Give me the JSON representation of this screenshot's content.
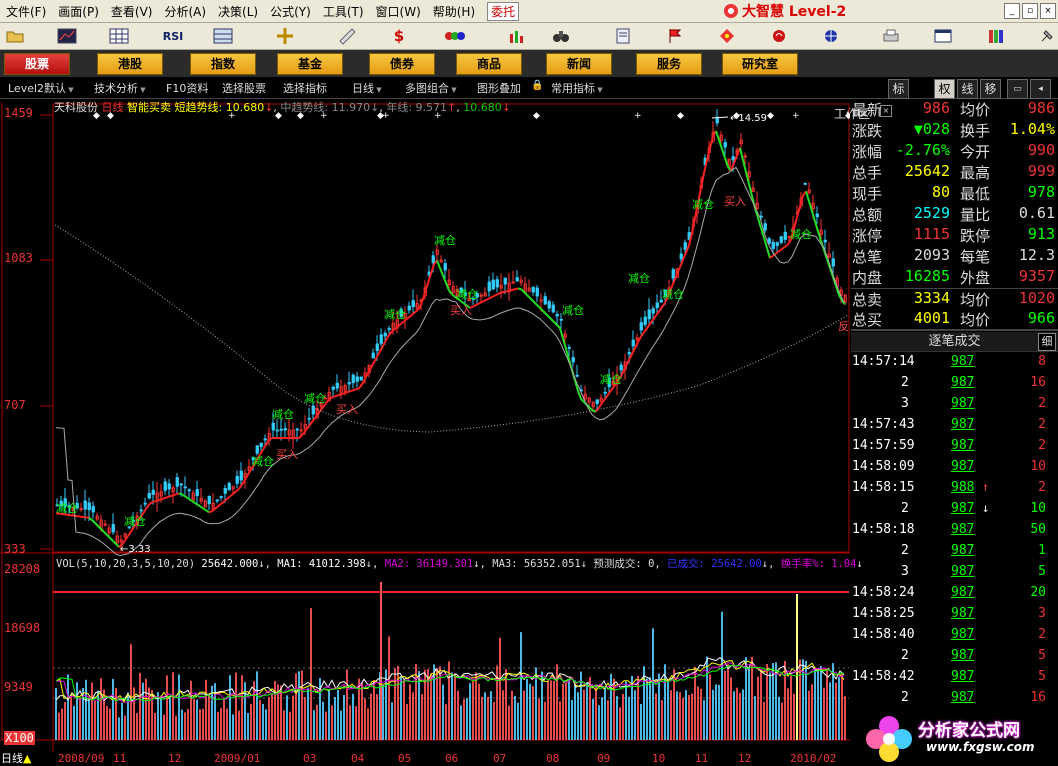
{
  "menu": [
    "文件(F)",
    "画面(P)",
    "查看(V)",
    "分析(A)",
    "决策(L)",
    "公式(Y)",
    "工具(T)",
    "窗口(W)",
    "帮助(H)"
  ],
  "entrust": "委托",
  "logo": "大智慧 Level-2",
  "nav": [
    "股票",
    "港股",
    "指数",
    "基金",
    "债券",
    "商品",
    "新闻",
    "服务",
    "研究室"
  ],
  "workarea": "工作区",
  "subbar": [
    "Level2默认",
    "技术分析",
    "F10资料",
    "选择股票",
    "选择指标",
    "日线",
    "多图组合",
    "图形叠加",
    "常用指标"
  ],
  "right_tabs": [
    "标",
    "权",
    "线",
    "移"
  ],
  "chart": {
    "title_name": "天科股份",
    "title_period": "日线",
    "title_ind": "智能买卖",
    "short_label": "短趋势线: 10.680",
    "mid_label": "中趋势线: 11.970",
    "year_label": "年线: 9.571",
    "extra_label": "10.680",
    "peak_label": "14.59",
    "low_label": "3.33",
    "y_labels": [
      "1459",
      "1083",
      "707",
      "333"
    ],
    "vol_labels": [
      "28208",
      "18698",
      "9349",
      "X100"
    ],
    "x_labels": [
      "2008/09",
      "11",
      "12",
      "2009/01",
      "03",
      "04",
      "05",
      "06",
      "07",
      "08",
      "09",
      "10",
      "11",
      "12",
      "2010/02"
    ],
    "vol_title": "VOL(5,10,20,3,5,10,20)",
    "vol_value": "25642.000",
    "ma1": "MA1: 41012.398",
    "ma2": "MA2: 36149.301",
    "ma3": "MA3: 56352.051",
    "forecast": "预测成交: 0,",
    "done": "已成交: 25642.00",
    "turnover": "换手率%: 1.04",
    "status": "日线",
    "signals": [
      "减仓",
      "买入",
      "减仓",
      "减仓",
      "减仓",
      "买入",
      "减仓",
      "买入",
      "减仓",
      "减仓",
      "减仓",
      "减仓",
      "减仓",
      "减仓",
      "买入",
      "减仓",
      "减仓",
      "反"
    ]
  },
  "quote": [
    {
      "k1": "最新",
      "v1": "986",
      "c1": "#e33",
      "k2": "均价",
      "v2": "986",
      "c2": "#e33"
    },
    {
      "k1": "涨跌",
      "v1": "▼028",
      "c1": "#0f0",
      "k2": "换手",
      "v2": "1.04%",
      "c2": "#ff0"
    },
    {
      "k1": "涨幅",
      "v1": "-2.76%",
      "c1": "#0f0",
      "k2": "今开",
      "v2": "990",
      "c2": "#e33"
    },
    {
      "k1": "总手",
      "v1": "25642",
      "c1": "#ff0",
      "k2": "最高",
      "v2": "999",
      "c2": "#e33"
    },
    {
      "k1": "现手",
      "v1": "80",
      "c1": "#ff0",
      "k2": "最低",
      "v2": "978",
      "c2": "#0f0"
    },
    {
      "k1": "总额",
      "v1": "2529",
      "c1": "#0ff",
      "k2": "量比",
      "v2": "0.61",
      "c2": "#ddd"
    },
    {
      "k1": "涨停",
      "v1": "1115",
      "c1": "#e33",
      "k2": "跌停",
      "v2": "913",
      "c2": "#0f0"
    },
    {
      "k1": "总笔",
      "v1": "2093",
      "c1": "#ddd",
      "k2": "每笔",
      "v2": "12.3",
      "c2": "#ddd"
    },
    {
      "k1": "内盘",
      "v1": "16285",
      "c1": "#0f0",
      "k2": "外盘",
      "v2": "9357",
      "c2": "#e33"
    },
    {
      "k1": "总卖",
      "v1": "3334",
      "c1": "#ff0",
      "k2": "均价",
      "v2": "1020",
      "c2": "#e33"
    },
    {
      "k1": "总买",
      "v1": "4001",
      "c1": "#ff0",
      "k2": "均价",
      "v2": "966",
      "c2": "#0f0"
    }
  ],
  "ticks_title": "逐笔成交",
  "ticks_btn": "细",
  "ticks": [
    {
      "t": "14:57:14",
      "p": "987",
      "a": "",
      "v": "8",
      "c": "#e33"
    },
    {
      "t": "2",
      "p": "987",
      "a": "",
      "v": "16",
      "c": "#e33"
    },
    {
      "t": "3",
      "p": "987",
      "a": "",
      "v": "2",
      "c": "#e33"
    },
    {
      "t": "14:57:43",
      "p": "987",
      "a": "",
      "v": "2",
      "c": "#e33"
    },
    {
      "t": "14:57:59",
      "p": "987",
      "a": "",
      "v": "2",
      "c": "#e33"
    },
    {
      "t": "14:58:09",
      "p": "987",
      "a": "",
      "v": "10",
      "c": "#e33"
    },
    {
      "t": "14:58:15",
      "p": "988",
      "a": "↑",
      "v": "2",
      "c": "#e33"
    },
    {
      "t": "2",
      "p": "987",
      "a": "↓",
      "v": "10",
      "c": "#0f0"
    },
    {
      "t": "14:58:18",
      "p": "987",
      "a": "",
      "v": "50",
      "c": "#0f0"
    },
    {
      "t": "2",
      "p": "987",
      "a": "",
      "v": "1",
      "c": "#0f0"
    },
    {
      "t": "3",
      "p": "987",
      "a": "",
      "v": "5",
      "c": "#0f0"
    },
    {
      "t": "14:58:24",
      "p": "987",
      "a": "",
      "v": "20",
      "c": "#0f0"
    },
    {
      "t": "14:58:25",
      "p": "987",
      "a": "",
      "v": "3",
      "c": "#e33"
    },
    {
      "t": "14:58:40",
      "p": "987",
      "a": "",
      "v": "2",
      "c": "#e33"
    },
    {
      "t": "2",
      "p": "987",
      "a": "",
      "v": "5",
      "c": "#e33"
    },
    {
      "t": "14:58:42",
      "p": "987",
      "a": "",
      "v": "5",
      "c": "#e33"
    },
    {
      "t": "2",
      "p": "987",
      "a": "",
      "v": "16",
      "c": "#e33"
    }
  ],
  "watermark": {
    "main": "分析家公式网",
    "sub": "www.fxgsw.com"
  }
}
